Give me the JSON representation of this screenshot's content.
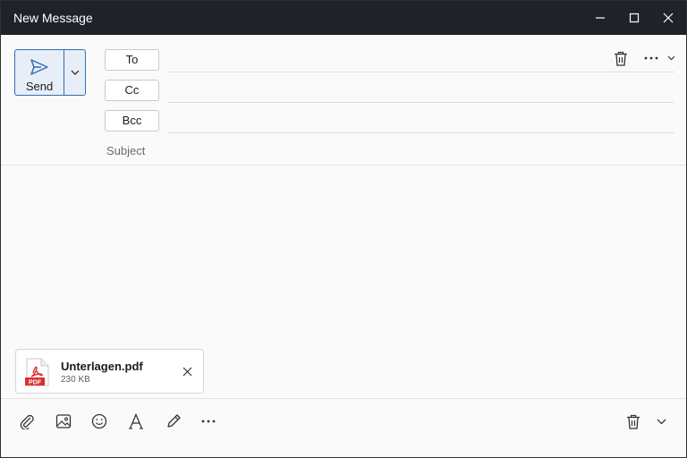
{
  "window": {
    "title": "New Message"
  },
  "compose": {
    "send_label": "Send",
    "to_label": "To",
    "cc_label": "Cc",
    "bcc_label": "Bcc",
    "subject_placeholder": "Subject",
    "to_value": "",
    "cc_value": "",
    "bcc_value": "",
    "subject_value": ""
  },
  "attachment": {
    "file_name": "Unterlagen.pdf",
    "file_size": "230 KB",
    "type_badge": "PDF"
  },
  "colors": {
    "titlebar": "#1f2329",
    "accent": "#2f6fb3",
    "pdf_red": "#d9302c"
  },
  "icons": {
    "header": [
      "trash-icon",
      "more-icon",
      "chevron-down-icon"
    ],
    "footer": [
      "paperclip-icon",
      "image-icon",
      "emoji-icon",
      "font-icon",
      "pen-icon",
      "more-icon",
      "trash-icon",
      "chevron-down-icon"
    ]
  }
}
